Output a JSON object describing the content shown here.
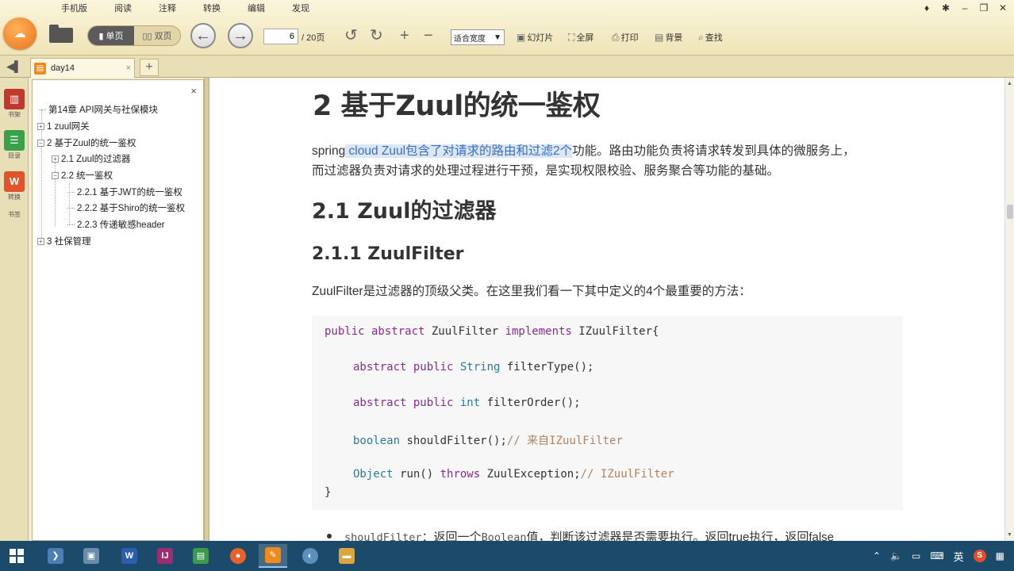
{
  "menu": [
    "手机版",
    "阅读",
    "注释",
    "转换",
    "编辑",
    "发现"
  ],
  "window_controls": [
    "pin",
    "gear",
    "minimize",
    "maximize",
    "close"
  ],
  "toolbar": {
    "logo_text": "",
    "single_page": "单页",
    "double_page": "双页",
    "page_current": "6",
    "page_total": "/ 20页",
    "fit_mode": "适合宽度",
    "slideshow": "幻灯片",
    "fullscreen": "全屏",
    "print": "打印",
    "background": "背景",
    "find": "查找"
  },
  "tab": {
    "label": "day14",
    "close": "×"
  },
  "rail": [
    {
      "label": "书架",
      "icon": "bookshelf-icon",
      "color": "#c0392b"
    },
    {
      "label": "目录",
      "icon": "outline-icon",
      "color": "#3aa04a"
    },
    {
      "label": "转换",
      "icon": "convert-icon",
      "color": "#e0532b"
    },
    {
      "label": "书签",
      "icon": "bookmark-icon",
      "color": "#888888"
    }
  ],
  "outline": {
    "close": "×",
    "items": [
      {
        "label": "第14章 API网关与社保模块",
        "level": 0,
        "expander": ""
      },
      {
        "label": "1 zuul网关",
        "level": 0,
        "expander": "+"
      },
      {
        "label": "2 基于Zuul的统一鉴权",
        "level": 0,
        "expander": "−"
      },
      {
        "label": "2.1 Zuul的过滤器",
        "level": 1,
        "expander": "+"
      },
      {
        "label": "2.2 统一鉴权",
        "level": 1,
        "expander": "−"
      },
      {
        "label": "2.2.1 基于JWT的统一鉴权",
        "level": 2,
        "expander": ""
      },
      {
        "label": "2.2.2 基于Shiro的统一鉴权",
        "level": 2,
        "expander": ""
      },
      {
        "label": "2.2.3 传递敏感header",
        "level": 2,
        "expander": ""
      },
      {
        "label": "3 社保管理",
        "level": 0,
        "expander": "+"
      }
    ]
  },
  "document": {
    "h1": "2 基于Zuul的统一鉴权",
    "p1_start": "spring",
    "p1_highlight": " cloud Zuul包含了对请求的路由和过滤2个",
    "p1_end": "功能。路由功能负责将请求转发到具体的微服务上，",
    "p1_line2": "而过滤器负责对请求的处理过程进行干预，是实现权限校验、服务聚合等功能的基础。",
    "h2": "2.1 Zuul的过滤器",
    "h3": "2.1.1 ZuulFilter",
    "p2": "ZuulFilter是过滤器的顶级父类。在这里我们看一下其中定义的4个最重要的方法：",
    "code": {
      "l1_kw": "public abstract ",
      "l1_name": "ZuulFilter ",
      "l1_kw2": "implements ",
      "l1_rest": "IZuulFilter{",
      "l2_kw": "abstract public ",
      "l2_ty": "String ",
      "l2_rest": "filterType();",
      "l3_kw": "abstract public ",
      "l3_ty": "int ",
      "l3_rest": "filterOrder();",
      "l4_ty": "boolean ",
      "l4_rest": "shouldFilter();",
      "l4_cm": "// 来自IZuulFilter",
      "l5_ty": "Object ",
      "l5_rest": "run() ",
      "l5_kw": "throws ",
      "l5_rest2": "ZuulException;",
      "l5_cm": "// IZuulFilter",
      "l6": "}"
    },
    "bullet_code": "shouldFilter",
    "bullet_text1": "：返回一个",
    "bullet_code2": "Boolean",
    "bullet_text2": "值，判断该过滤器是否需要执行。返回true执行，返回false"
  },
  "taskbar": {
    "apps": [
      {
        "name": "app-1",
        "color": "#4a7fb5",
        "glyph": "❯"
      },
      {
        "name": "app-2",
        "color": "#6a8ca8",
        "glyph": "▣"
      },
      {
        "name": "app-3",
        "color": "#2b5fae",
        "glyph": "W"
      },
      {
        "name": "app-4",
        "color": "#9c2d6e",
        "glyph": "IJ"
      },
      {
        "name": "app-5",
        "color": "#3c9a4a",
        "glyph": "▤"
      },
      {
        "name": "app-6",
        "color": "#e6622a",
        "glyph": "●"
      },
      {
        "name": "app-7",
        "color": "#f08a1c",
        "glyph": "✎"
      },
      {
        "name": "app-8",
        "color": "#5b8fbf",
        "glyph": "◐"
      },
      {
        "name": "app-9",
        "color": "#d9a640",
        "glyph": "▬"
      }
    ],
    "ime": "英",
    "sogou": "S"
  }
}
